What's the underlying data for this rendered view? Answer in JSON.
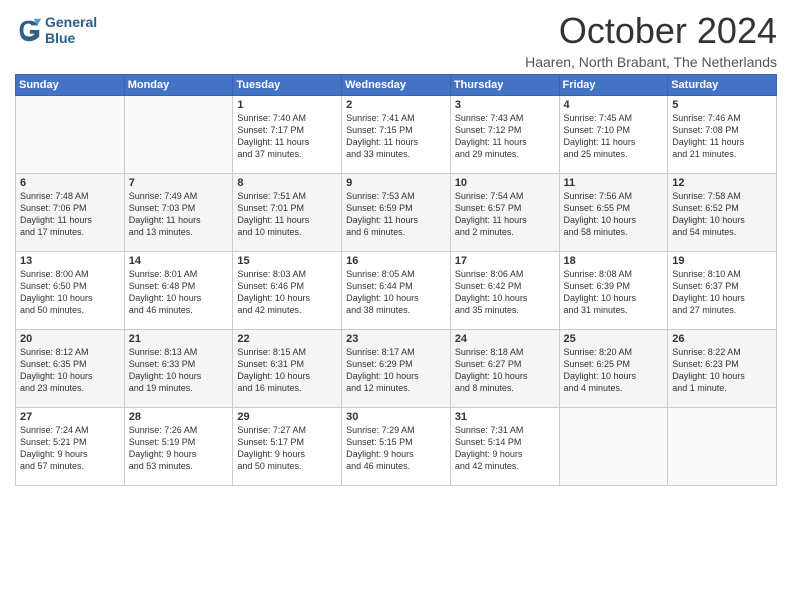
{
  "header": {
    "logo_line1": "General",
    "logo_line2": "Blue",
    "month": "October 2024",
    "location": "Haaren, North Brabant, The Netherlands"
  },
  "days_of_week": [
    "Sunday",
    "Monday",
    "Tuesday",
    "Wednesday",
    "Thursday",
    "Friday",
    "Saturday"
  ],
  "weeks": [
    [
      {
        "day": "",
        "text": ""
      },
      {
        "day": "",
        "text": ""
      },
      {
        "day": "1",
        "text": "Sunrise: 7:40 AM\nSunset: 7:17 PM\nDaylight: 11 hours\nand 37 minutes."
      },
      {
        "day": "2",
        "text": "Sunrise: 7:41 AM\nSunset: 7:15 PM\nDaylight: 11 hours\nand 33 minutes."
      },
      {
        "day": "3",
        "text": "Sunrise: 7:43 AM\nSunset: 7:12 PM\nDaylight: 11 hours\nand 29 minutes."
      },
      {
        "day": "4",
        "text": "Sunrise: 7:45 AM\nSunset: 7:10 PM\nDaylight: 11 hours\nand 25 minutes."
      },
      {
        "day": "5",
        "text": "Sunrise: 7:46 AM\nSunset: 7:08 PM\nDaylight: 11 hours\nand 21 minutes."
      }
    ],
    [
      {
        "day": "6",
        "text": "Sunrise: 7:48 AM\nSunset: 7:06 PM\nDaylight: 11 hours\nand 17 minutes."
      },
      {
        "day": "7",
        "text": "Sunrise: 7:49 AM\nSunset: 7:03 PM\nDaylight: 11 hours\nand 13 minutes."
      },
      {
        "day": "8",
        "text": "Sunrise: 7:51 AM\nSunset: 7:01 PM\nDaylight: 11 hours\nand 10 minutes."
      },
      {
        "day": "9",
        "text": "Sunrise: 7:53 AM\nSunset: 6:59 PM\nDaylight: 11 hours\nand 6 minutes."
      },
      {
        "day": "10",
        "text": "Sunrise: 7:54 AM\nSunset: 6:57 PM\nDaylight: 11 hours\nand 2 minutes."
      },
      {
        "day": "11",
        "text": "Sunrise: 7:56 AM\nSunset: 6:55 PM\nDaylight: 10 hours\nand 58 minutes."
      },
      {
        "day": "12",
        "text": "Sunrise: 7:58 AM\nSunset: 6:52 PM\nDaylight: 10 hours\nand 54 minutes."
      }
    ],
    [
      {
        "day": "13",
        "text": "Sunrise: 8:00 AM\nSunset: 6:50 PM\nDaylight: 10 hours\nand 50 minutes."
      },
      {
        "day": "14",
        "text": "Sunrise: 8:01 AM\nSunset: 6:48 PM\nDaylight: 10 hours\nand 46 minutes."
      },
      {
        "day": "15",
        "text": "Sunrise: 8:03 AM\nSunset: 6:46 PM\nDaylight: 10 hours\nand 42 minutes."
      },
      {
        "day": "16",
        "text": "Sunrise: 8:05 AM\nSunset: 6:44 PM\nDaylight: 10 hours\nand 38 minutes."
      },
      {
        "day": "17",
        "text": "Sunrise: 8:06 AM\nSunset: 6:42 PM\nDaylight: 10 hours\nand 35 minutes."
      },
      {
        "day": "18",
        "text": "Sunrise: 8:08 AM\nSunset: 6:39 PM\nDaylight: 10 hours\nand 31 minutes."
      },
      {
        "day": "19",
        "text": "Sunrise: 8:10 AM\nSunset: 6:37 PM\nDaylight: 10 hours\nand 27 minutes."
      }
    ],
    [
      {
        "day": "20",
        "text": "Sunrise: 8:12 AM\nSunset: 6:35 PM\nDaylight: 10 hours\nand 23 minutes."
      },
      {
        "day": "21",
        "text": "Sunrise: 8:13 AM\nSunset: 6:33 PM\nDaylight: 10 hours\nand 19 minutes."
      },
      {
        "day": "22",
        "text": "Sunrise: 8:15 AM\nSunset: 6:31 PM\nDaylight: 10 hours\nand 16 minutes."
      },
      {
        "day": "23",
        "text": "Sunrise: 8:17 AM\nSunset: 6:29 PM\nDaylight: 10 hours\nand 12 minutes."
      },
      {
        "day": "24",
        "text": "Sunrise: 8:18 AM\nSunset: 6:27 PM\nDaylight: 10 hours\nand 8 minutes."
      },
      {
        "day": "25",
        "text": "Sunrise: 8:20 AM\nSunset: 6:25 PM\nDaylight: 10 hours\nand 4 minutes."
      },
      {
        "day": "26",
        "text": "Sunrise: 8:22 AM\nSunset: 6:23 PM\nDaylight: 10 hours\nand 1 minute."
      }
    ],
    [
      {
        "day": "27",
        "text": "Sunrise: 7:24 AM\nSunset: 5:21 PM\nDaylight: 9 hours\nand 57 minutes."
      },
      {
        "day": "28",
        "text": "Sunrise: 7:26 AM\nSunset: 5:19 PM\nDaylight: 9 hours\nand 53 minutes."
      },
      {
        "day": "29",
        "text": "Sunrise: 7:27 AM\nSunset: 5:17 PM\nDaylight: 9 hours\nand 50 minutes."
      },
      {
        "day": "30",
        "text": "Sunrise: 7:29 AM\nSunset: 5:15 PM\nDaylight: 9 hours\nand 46 minutes."
      },
      {
        "day": "31",
        "text": "Sunrise: 7:31 AM\nSunset: 5:14 PM\nDaylight: 9 hours\nand 42 minutes."
      },
      {
        "day": "",
        "text": ""
      },
      {
        "day": "",
        "text": ""
      }
    ]
  ]
}
